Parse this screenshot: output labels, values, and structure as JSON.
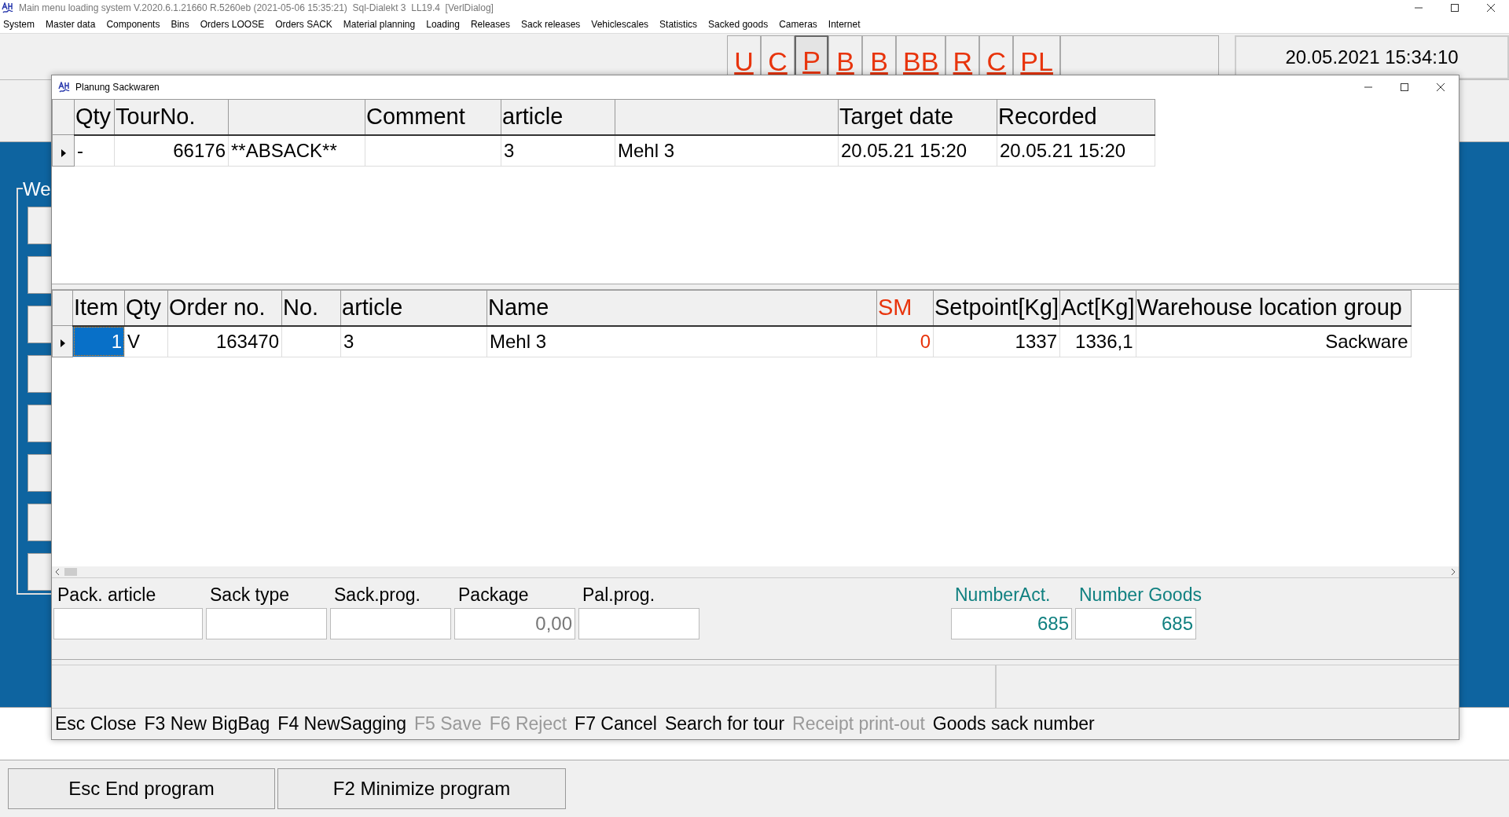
{
  "main_window": {
    "title": "Main menu loading system V.2020.6.1.21660 R.5260eb (2021-05-06 15:35:21)  Sql-Dialekt 3  LL19.4  [VerlDialog]",
    "menu": [
      "System",
      "Master data",
      "Components",
      "Bins",
      "Orders LOOSE",
      "Orders SACK",
      "Material planning",
      "Loading",
      "Releases",
      "Sack releases",
      "Vehiclescales",
      "Statistics",
      "Sacked goods",
      "Cameras",
      "Internet"
    ],
    "toolbar": [
      {
        "label": "U",
        "selected": false
      },
      {
        "label": "C",
        "selected": false
      },
      {
        "label": "P",
        "selected": true
      },
      {
        "label": "B",
        "selected": false
      },
      {
        "label": "B",
        "selected": false
      },
      {
        "label": "BB",
        "selected": false
      },
      {
        "label": "R",
        "selected": false
      },
      {
        "label": "C",
        "selected": false
      },
      {
        "label": "PL",
        "selected": false
      }
    ],
    "datetime": "20.05.2021 15:34:10",
    "group_box": {
      "title": "We"
    },
    "buttons": [
      "Esc End program",
      "F2 Minimize program"
    ]
  },
  "dialog": {
    "title": "Planung Sackwaren",
    "tour_grid": {
      "columns": [
        {
          "label": "Qty",
          "kind": "text"
        },
        {
          "label": "TourNo.",
          "kind": "number"
        },
        {
          "kind": "text"
        },
        {
          "label": "Comment",
          "kind": "text"
        },
        {
          "label": "article",
          "kind": "text"
        },
        {
          "kind": "text"
        },
        {
          "label": "Target date",
          "kind": "text"
        },
        {
          "label": "Recorded",
          "kind": "text"
        }
      ],
      "rows": [
        {
          "current": true,
          "cells": [
            "-",
            "66176",
            "**ABSACK**",
            "",
            "3",
            "Mehl 3",
            "20.05.21 15:20",
            "20.05.21 15:20"
          ]
        }
      ]
    },
    "item_grid": {
      "columns": [
        {
          "label": "Item",
          "kind": "number"
        },
        {
          "label": "Qty",
          "kind": "text"
        },
        {
          "label": "Order no.",
          "kind": "number"
        },
        {
          "label": "No.",
          "kind": "text"
        },
        {
          "label": "article",
          "kind": "text"
        },
        {
          "label": "Name",
          "kind": "text"
        },
        {
          "label": "SM",
          "kind": "number",
          "color": "#e8340c"
        },
        {
          "label": "Setpoint[Kg]",
          "kind": "number"
        },
        {
          "label": "Act[Kg]",
          "kind": "number"
        },
        {
          "label": "Warehouse location group",
          "kind": "number"
        }
      ],
      "rows": [
        {
          "current": true,
          "cells": [
            {
              "text": "1",
              "selected": true
            },
            {
              "text": "V",
              "selected": false
            },
            {
              "text": "163470",
              "selected": false
            },
            {
              "text": "",
              "selected": false
            },
            {
              "text": "3",
              "selected": false
            },
            {
              "text": "Mehl 3",
              "selected": false
            },
            {
              "text": "0",
              "selected": false
            },
            {
              "text": "1337",
              "selected": false
            },
            {
              "text": "1336,1",
              "selected": false
            },
            {
              "text": "Sackware",
              "selected": false
            }
          ]
        }
      ]
    },
    "fields": [
      {
        "label": "Pack. article",
        "kind": "input"
      },
      {
        "label": "Sack type",
        "kind": "input"
      },
      {
        "label": "Sack.prog.",
        "kind": "input"
      },
      {
        "label": "Package",
        "kind": "input",
        "value": "0,00"
      },
      {
        "label": "Pal.prog.",
        "kind": "input"
      },
      {
        "label": "NumberAct.",
        "kind": "counter",
        "value": "685"
      },
      {
        "label": "Number Goods",
        "kind": "counter",
        "value": "685"
      }
    ],
    "function_keys": [
      {
        "label": "Esc Close",
        "disabled": false
      },
      {
        "label": "F3 New BigBag",
        "disabled": false
      },
      {
        "label": "F4 NewSagging",
        "disabled": false
      },
      {
        "label": "F5 Save",
        "disabled": true
      },
      {
        "label": "F6 Reject",
        "disabled": true
      },
      {
        "label": "F7 Cancel",
        "disabled": false
      },
      {
        "label": "Search for tour",
        "disabled": false
      },
      {
        "label": "Receipt print-out",
        "disabled": true
      },
      {
        "label": "Goods sack number",
        "disabled": false
      }
    ]
  }
}
